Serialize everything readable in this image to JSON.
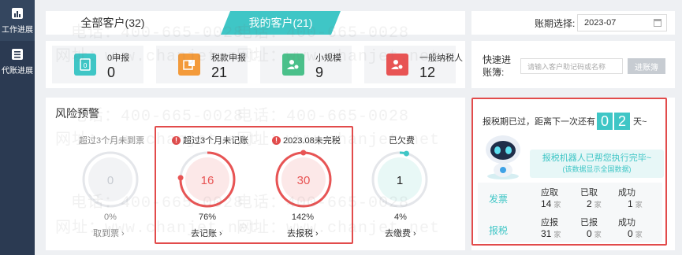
{
  "nav": {
    "items": [
      {
        "label": "工作进展",
        "icon": "chart-icon"
      },
      {
        "label": "代账进展",
        "icon": "list-icon"
      }
    ]
  },
  "tabs": {
    "all_label": "全部客户(32)",
    "mine_label": "我的客户(21)"
  },
  "period": {
    "label": "账期选择:",
    "value": "2023-07"
  },
  "stats": [
    {
      "label": "0申报",
      "value": "0",
      "color": "#3fc6c6"
    },
    {
      "label": "税款申报",
      "value": "21",
      "color": "#f39a3a"
    },
    {
      "label": "小规模",
      "value": "9",
      "color": "#4ac08a"
    },
    {
      "label": "一般纳税人",
      "value": "12",
      "color": "#e85454"
    }
  ],
  "quick": {
    "label": "快速进账簿:",
    "placeholder": "请输入客户助记码或名称",
    "button": "进账簿"
  },
  "risk": {
    "title": "风险预警",
    "gauges": [
      {
        "title": "超过3个月未到票",
        "value": "0",
        "percent": "0%",
        "link": "取到票",
        "warn": false,
        "progress": 0,
        "color": "#cfd3d8"
      },
      {
        "title": "超过3个月未记账",
        "value": "16",
        "percent": "76%",
        "link": "去记账",
        "warn": true,
        "progress": 0.76,
        "color": "#e85454"
      },
      {
        "title": "2023.08未完税",
        "value": "30",
        "percent": "142%",
        "link": "去报税",
        "warn": true,
        "progress": 1.0,
        "color": "#e85454"
      },
      {
        "title": "已欠费",
        "value": "1",
        "percent": "4%",
        "link": "去缴费",
        "warn": false,
        "progress": 0.04,
        "color": "#3fc6c6"
      }
    ]
  },
  "right": {
    "countdown_prefix": "报税期已过，距离下一次还有",
    "digits": [
      "0",
      "2"
    ],
    "countdown_suffix": "天~",
    "bubble_main": "报税机器人已帮您执行完毕~",
    "bubble_sub": "(该数据显示全国数据)",
    "rows": [
      {
        "label": "发票",
        "cols": [
          {
            "h": "应取",
            "v": "14"
          },
          {
            "h": "已取",
            "v": "2"
          },
          {
            "h": "成功",
            "v": "1"
          }
        ]
      },
      {
        "label": "报税",
        "cols": [
          {
            "h": "应报",
            "v": "31"
          },
          {
            "h": "已报",
            "v": "0"
          },
          {
            "h": "成功",
            "v": "0"
          }
        ]
      }
    ],
    "unit": "家"
  },
  "watermark": [
    "电话：400-665-0028",
    "网址：www.chanjet.net"
  ]
}
